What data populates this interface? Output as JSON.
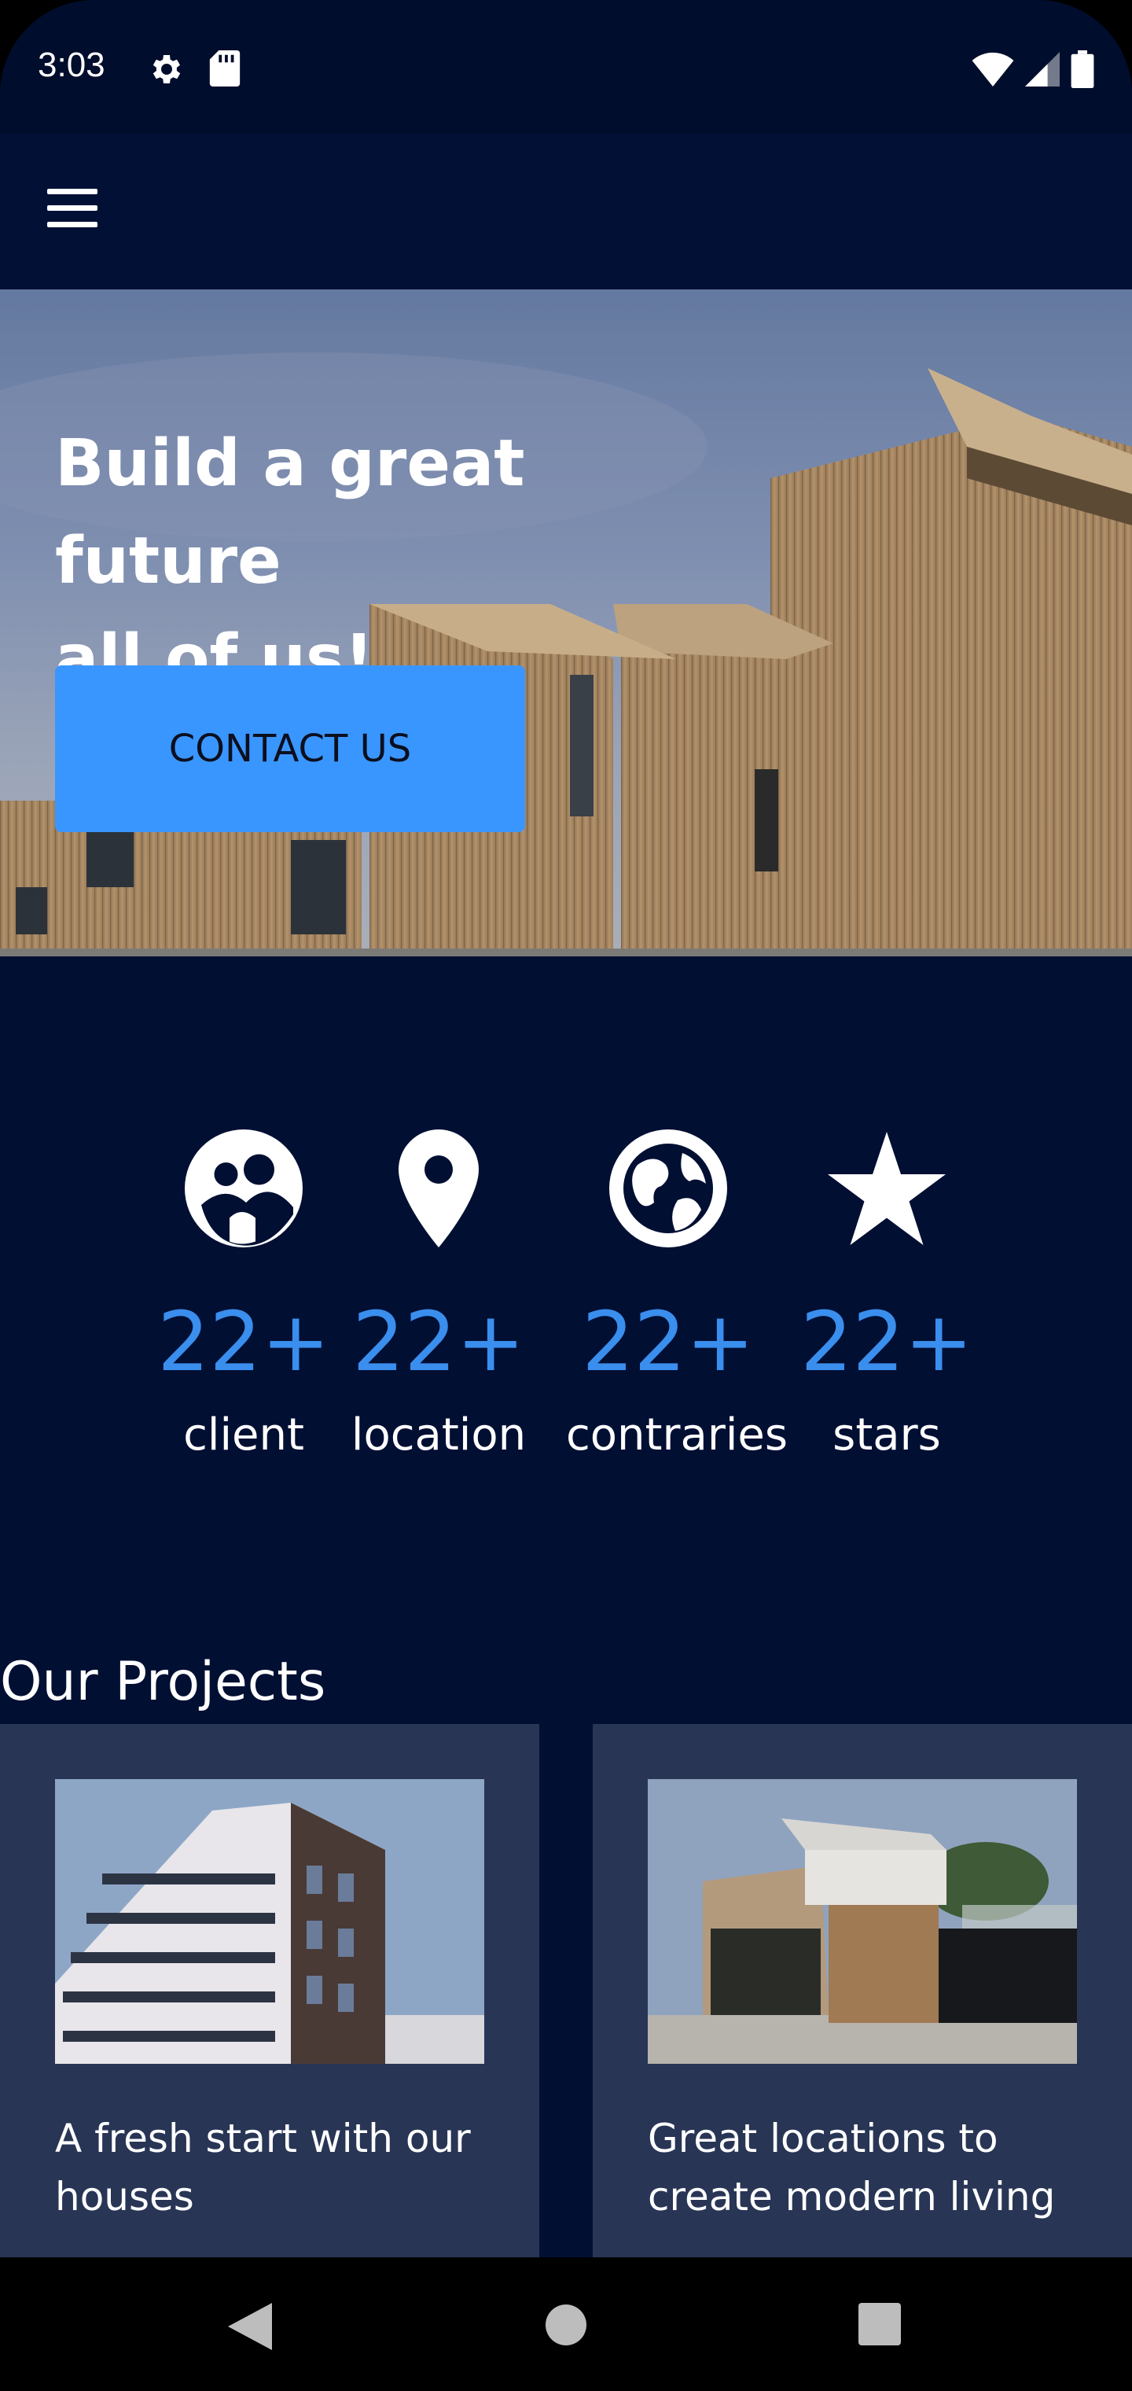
{
  "status_bar": {
    "time": "3:03",
    "icons": [
      "gear-icon",
      "sd-card-icon",
      "wifi-icon",
      "signal-icon",
      "battery-icon"
    ]
  },
  "app_bar": {
    "menu_icon": "hamburger-menu-icon"
  },
  "hero": {
    "title": "Build a great future\n all of us!",
    "cta_label": "CONTACT US"
  },
  "stats": [
    {
      "icon": "people-icon",
      "value": "22+",
      "label": "client"
    },
    {
      "icon": "location-pin-icon",
      "value": "22+",
      "label": "location"
    },
    {
      "icon": "globe-icon",
      "value": "22+",
      "label": "contraries"
    },
    {
      "icon": "star-icon",
      "value": "22+",
      "label": "stars"
    }
  ],
  "projects": {
    "title": "Our Projects",
    "items": [
      {
        "caption": "A fresh start with our houses"
      },
      {
        "caption": "Great locations to create modern living"
      }
    ]
  },
  "nav_bar": {
    "icons": [
      "back-icon",
      "home-icon",
      "recents-icon"
    ]
  },
  "colors": {
    "background": "#010f33",
    "accent": "#3a96ff",
    "stat_value": "#3a8eed",
    "card": "#283555"
  }
}
